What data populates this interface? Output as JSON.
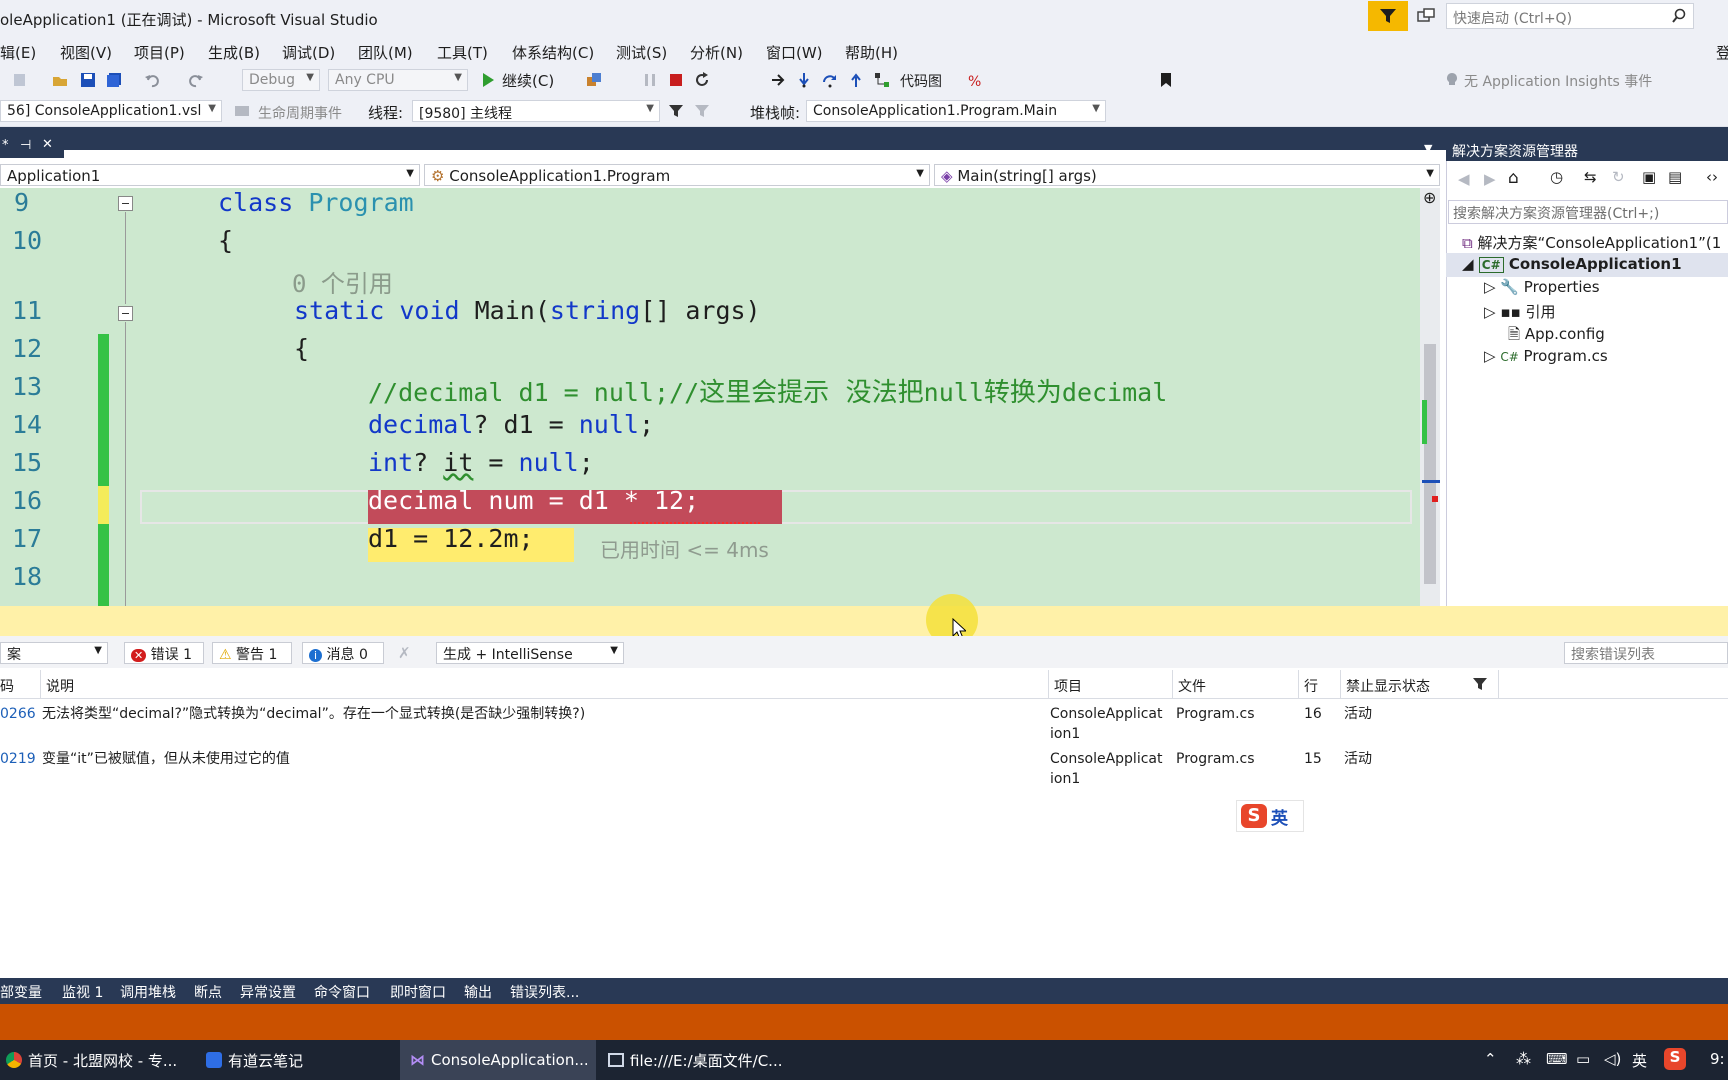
{
  "window": {
    "title": "oleApplication1 (正在调试) - Microsoft Visual Studio"
  },
  "quick_launch": {
    "placeholder": "快速启动 (Ctrl+Q)"
  },
  "menu": [
    "辑(E)",
    "视图(V)",
    "项目(P)",
    "生成(B)",
    "调试(D)",
    "团队(M)",
    "工具(T)",
    "体系结构(C)",
    "测试(S)",
    "分析(N)",
    "窗口(W)",
    "帮助(H)"
  ],
  "menu_right": "登",
  "toolbar": {
    "config": "Debug",
    "platform": "Any CPU",
    "continue": "继续(C)",
    "code_map": "代码图",
    "insights": "无 Application Insights 事件"
  },
  "debug_location": {
    "process": "56] ConsoleApplication1.vsl",
    "lifecycle": "生命周期事件",
    "thread_label": "线程:",
    "thread": "[9580] 主线程",
    "stack_label": "堆栈帧:",
    "stack": "ConsoleApplication1.Program.Main"
  },
  "editor": {
    "nav": {
      "project": "Application1",
      "class": "ConsoleApplication1.Program",
      "member": "Main(string[] args)"
    },
    "lines": {
      "l9": "9",
      "l10": "10",
      "l11": "11",
      "l12": "12",
      "l13": "13",
      "l14": "14",
      "l15": "15",
      "l16": "16",
      "l17": "17",
      "l18": "18"
    },
    "code": {
      "class_kw": "class",
      "class_name": "Program",
      "brace_open": "{",
      "refs": "0 个引用",
      "static_void": "static void",
      "main_name": " Main(",
      "string_kw": "string",
      "main_rest": "[] args)",
      "comment_a": "//decimal d1 = null;//",
      "comment_zh1": "这里会提示  没法把",
      "comment_b": "null",
      "comment_zh2": "转换为",
      "comment_c": "decimal",
      "decimal_kw": "decimal",
      "line14_rest": "? d1 = ",
      "null_kw": "null",
      "semi": ";",
      "int_kw": "int",
      "line15_q": "? ",
      "it_var": "it",
      "line15_rest": " = ",
      "line16": "decimal num = d1 * 12;",
      "line17": "d1 = 12.2m;",
      "elapsed": "已用时间 <= 4ms"
    }
  },
  "solution_explorer": {
    "title": "解决方案资源管理器",
    "search_placeholder": "搜索解决方案资源管理器(Ctrl+;)",
    "items": [
      {
        "label": "解决方案“ConsoleApplication1”(1"
      },
      {
        "label": "ConsoleApplication1"
      },
      {
        "label": "Properties"
      },
      {
        "label": "引用"
      },
      {
        "label": "App.config"
      },
      {
        "label": "Program.cs"
      }
    ]
  },
  "error_list": {
    "scope": "案",
    "errors": "错误 1",
    "warnings": "警告 1",
    "messages": "消息 0",
    "source": "生成 + IntelliSense",
    "search_placeholder": "搜索错误列表",
    "columns": {
      "code": "码",
      "desc": "说明",
      "project": "项目",
      "file": "文件",
      "line": "行",
      "suppress": "禁止显示状态"
    },
    "rows": [
      {
        "code": "0266",
        "desc": "无法将类型“decimal?”隐式转换为“decimal”。存在一个显式转换(是否缺少强制转换?)",
        "project_a": "ConsoleApplicat",
        "project_b": "ion1",
        "file": "Program.cs",
        "line": "16",
        "state": "活动"
      },
      {
        "code": "0219",
        "desc": "变量“it”已被赋值，但从未使用过它的值",
        "project_a": "ConsoleApplicat",
        "project_b": "ion1",
        "file": "Program.cs",
        "line": "15",
        "state": "活动"
      }
    ]
  },
  "ime": {
    "label": "英"
  },
  "bottom_tabs": [
    "部变量",
    "监视 1",
    "调用堆栈",
    "断点",
    "异常设置",
    "命令窗口",
    "即时窗口",
    "输出",
    "错误列表..."
  ],
  "taskbar": {
    "items": [
      {
        "label": "首页 - 北盟网校 - 专..."
      },
      {
        "label": "有道云笔记"
      },
      {
        "label": "ConsoleApplication..."
      },
      {
        "label": "file:///E:/桌面文件/C..."
      }
    ],
    "tray_lang": "英",
    "clock": "9:"
  },
  "colors": {
    "vs_dark": "#293955",
    "debug_status": "#ca5100",
    "editor_bg": "#cde8cf",
    "error_line": "#c24b5a",
    "next_stmt": "#ffec6e"
  }
}
